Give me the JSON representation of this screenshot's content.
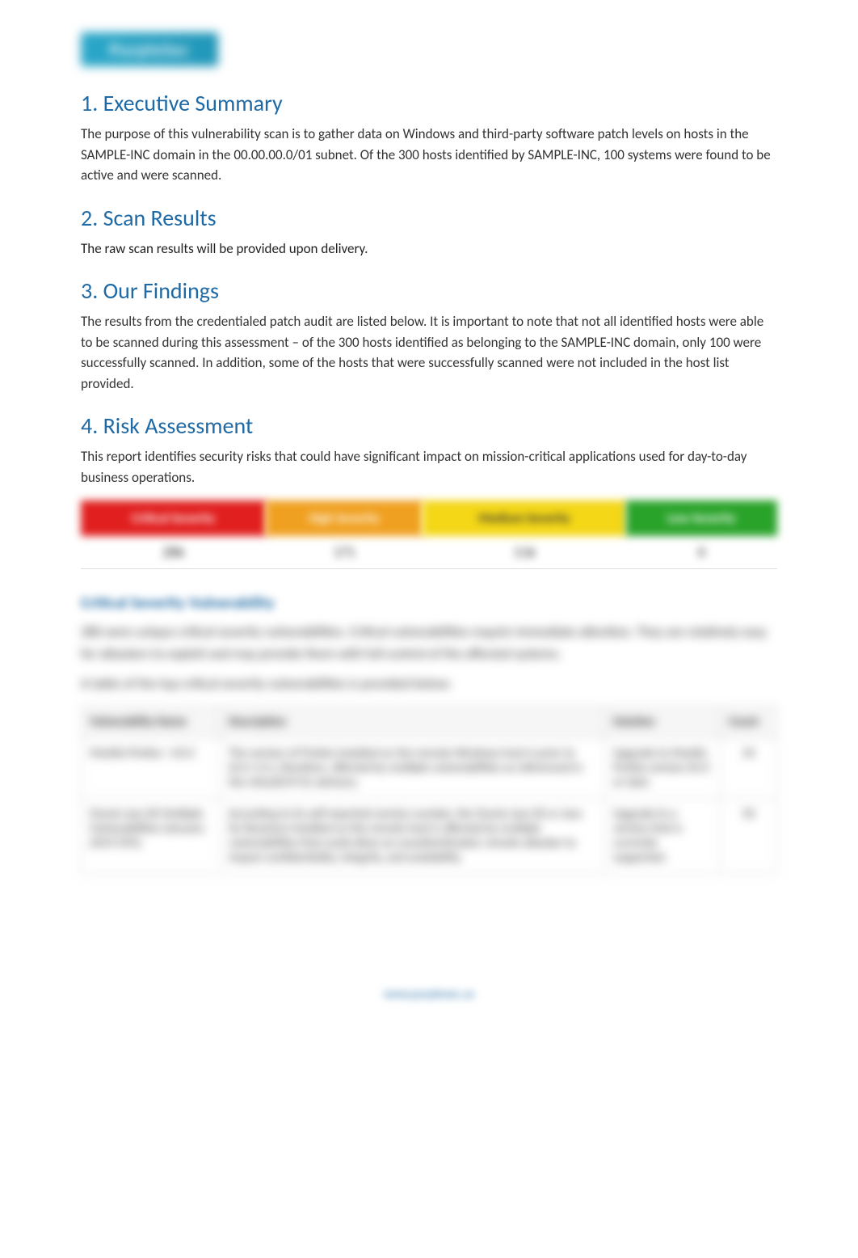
{
  "logo_text": "PurpleSec",
  "sections": {
    "s1": {
      "heading": "1. Executive Summary",
      "text": "The purpose of this vulnerability scan is to gather data on Windows and third-party software patch levels on hosts in the SAMPLE-INC domain in the 00.00.00.0/01 subnet. Of the 300 hosts identified by SAMPLE-INC, 100 systems were found to be active and were scanned."
    },
    "s2": {
      "heading": "2. Scan Results",
      "text": "The raw scan results will be provided upon delivery."
    },
    "s3": {
      "heading": "3. Our Findings",
      "text": "The results from the credentialed patch audit are listed below. It is important to note that not all identified hosts were able to be scanned during this assessment – of the 300 hosts identified as belonging to the SAMPLE-INC domain, only 100 were successfully scanned. In addition, some of the hosts that were successfully scanned were not included in the host list provided."
    },
    "s4": {
      "heading": "4. Risk Assessment",
      "text": "This report identifies security risks that could have significant impact on mission-critical applications used for day-to-day business operations."
    }
  },
  "risk_levels": {
    "headers": {
      "critical": "Critical Severity",
      "high": "High Severity",
      "medium": "Medium Severity",
      "low": "Low Severity"
    },
    "values": {
      "critical": "286",
      "high": "171",
      "medium": "116",
      "low": "0"
    }
  },
  "critical_section": {
    "heading": "Critical Severity Vulnerability",
    "para1": "286 were unique critical severity vulnerabilities. Critical vulnerabilities require immediate attention. They are relatively easy for attackers to exploit and may provide them with full control of the affected systems.",
    "para2": "A table of the top critical severity vulnerabilities is provided below:"
  },
  "vuln_table": {
    "headers": {
      "name": "Vulnerability Name",
      "desc": "Description",
      "sol": "Solution",
      "count": "Count"
    },
    "rows": [
      {
        "name": "Mozilla Firefox < 65.0",
        "desc": "The version of Firefox installed on the remote Windows host is prior to 65.0. It is, therefore, affected by multiple vulnerabilities as referenced in the mfsa2019-01 advisory.",
        "sol": "Upgrade to Mozilla Firefox version 65.0 or later.",
        "count": "34"
      },
      {
        "name": "Oracle Java SE Multiple Vulnerabilities (January 2019 CPU)",
        "desc": "According to its self-reported version number, the Oracle Java SE or Java for Business installed on the remote host is affected by multiple vulnerabilities that could allow an unauthenticated, remote attacker to impact confidentiality, integrity, and availability.",
        "sol": "Upgrade to a version that is currently supported.",
        "count": "50"
      }
    ]
  },
  "footer_text": "www.purplesec.us"
}
